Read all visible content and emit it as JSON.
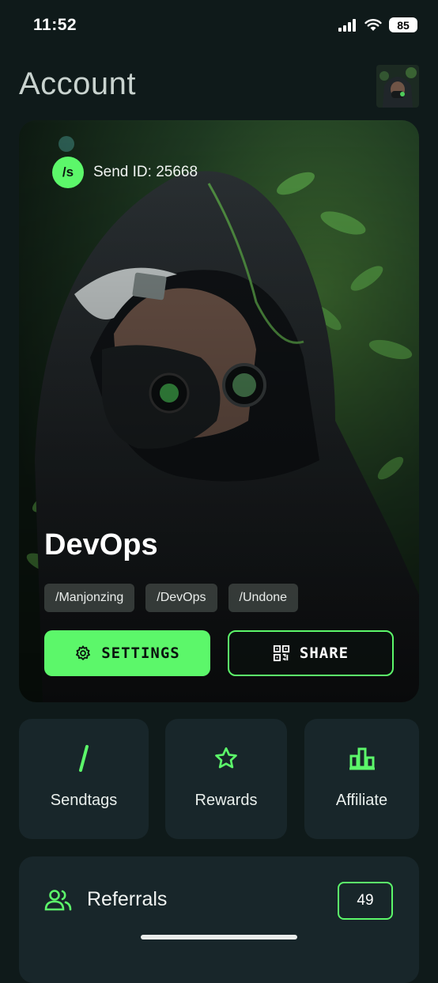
{
  "status": {
    "time": "11:52",
    "battery": "85"
  },
  "page": {
    "title": "Account"
  },
  "profile": {
    "send_id_badge": "/s",
    "send_id": "Send ID: 25668",
    "name": "DevOps",
    "tags": [
      "/Manjonzing",
      "/DevOps",
      "/Undone"
    ],
    "settings_label": "SETTINGS",
    "share_label": "SHARE"
  },
  "quick_links": [
    {
      "label": "Sendtags",
      "icon": "slash-icon"
    },
    {
      "label": "Rewards",
      "icon": "star-icon"
    },
    {
      "label": "Affiliate",
      "icon": "bar-chart-icon"
    }
  ],
  "referrals": {
    "label": "Referrals",
    "count": "49",
    "icon": "users-icon"
  },
  "colors": {
    "accent": "#5cf76a",
    "background": "#0f1a1a",
    "card": "#18262a"
  }
}
